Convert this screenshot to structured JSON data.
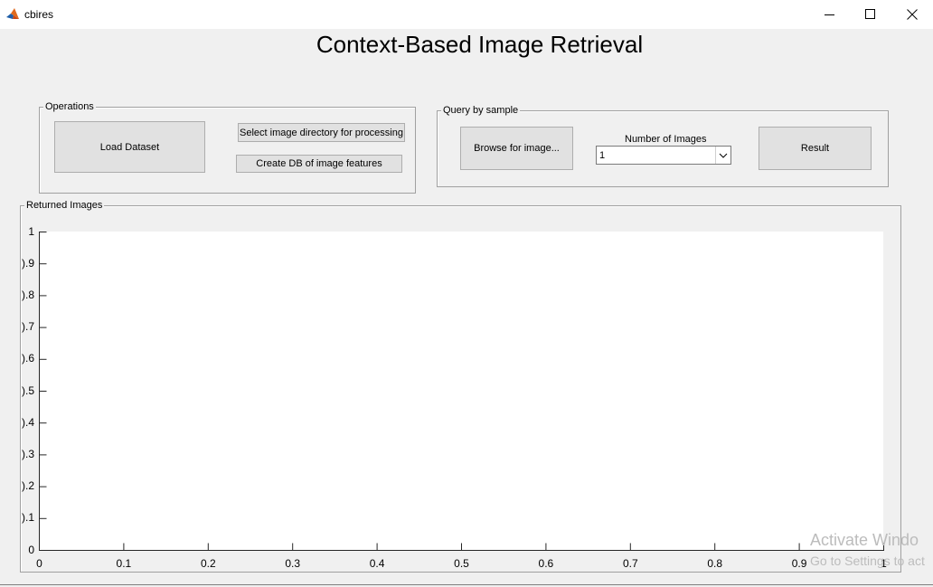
{
  "window": {
    "title": "cbires",
    "icon": "matlab-logo-icon",
    "controls": [
      "minimize-icon",
      "maximize-icon",
      "close-icon"
    ]
  },
  "heading": "Context-Based Image Retrieval",
  "operations": {
    "legend": "Operations",
    "load_dataset": "Load Dataset",
    "select_dir": "Select image directory for processing",
    "create_db": "Create DB of image features"
  },
  "query": {
    "legend": "Query by sample",
    "browse": "Browse for image...",
    "num_images_label": "Number of Images",
    "num_images_value": "1",
    "result": "Result"
  },
  "returned": {
    "legend": "Returned Images",
    "x_ticks": [
      "0",
      "0.1",
      "0.2",
      "0.3",
      "0.4",
      "0.5",
      "0.6",
      "0.7",
      "0.8",
      "0.9",
      "1"
    ],
    "y_ticks": [
      "0",
      ").1",
      ").2",
      ").3",
      ").4",
      ").5",
      ").6",
      ").7",
      ").8",
      ").9",
      "1"
    ]
  },
  "watermark": {
    "line1": "Activate Windo",
    "line2": "Go to Settings to act"
  }
}
